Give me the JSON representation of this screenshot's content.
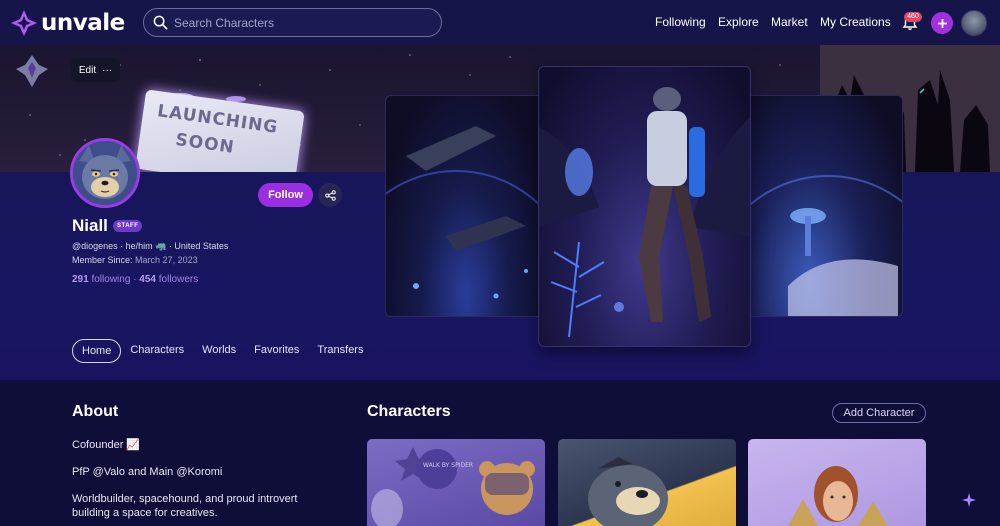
{
  "nav": {
    "brand": "unvale",
    "search_placeholder": "Search Characters",
    "links": [
      "Following",
      "Explore",
      "Market",
      "My Creations"
    ],
    "notification_count": "460",
    "accent": "#9b2ee0"
  },
  "banner": {
    "edit_label": "Edit",
    "edit_more": "···",
    "sign_line1": "LAUNCHING",
    "sign_line2": "SOON"
  },
  "profile": {
    "name": "Niall",
    "role_badge": "STAFF",
    "meta": "@diogenes · he/him 🦏 · United States",
    "member_since_label": "Member Since:",
    "member_since_value": "March 27, 2023",
    "following_count": "291",
    "following_label": "following",
    "separator": "·",
    "followers_count": "454",
    "followers_label": "followers",
    "follow_label": "Follow"
  },
  "tabs": [
    "Home",
    "Characters",
    "Worlds",
    "Favorites",
    "Transfers"
  ],
  "about": {
    "title": "About",
    "lines": [
      "Cofounder 📈",
      "PfP @Valo and Main @Koromi",
      "Worldbuilder, spacehound, and proud introvert building a space for creatives."
    ]
  },
  "characters": {
    "title": "Characters",
    "add_label": "Add Character",
    "card1_sign": "WALK BY SPIDER"
  }
}
